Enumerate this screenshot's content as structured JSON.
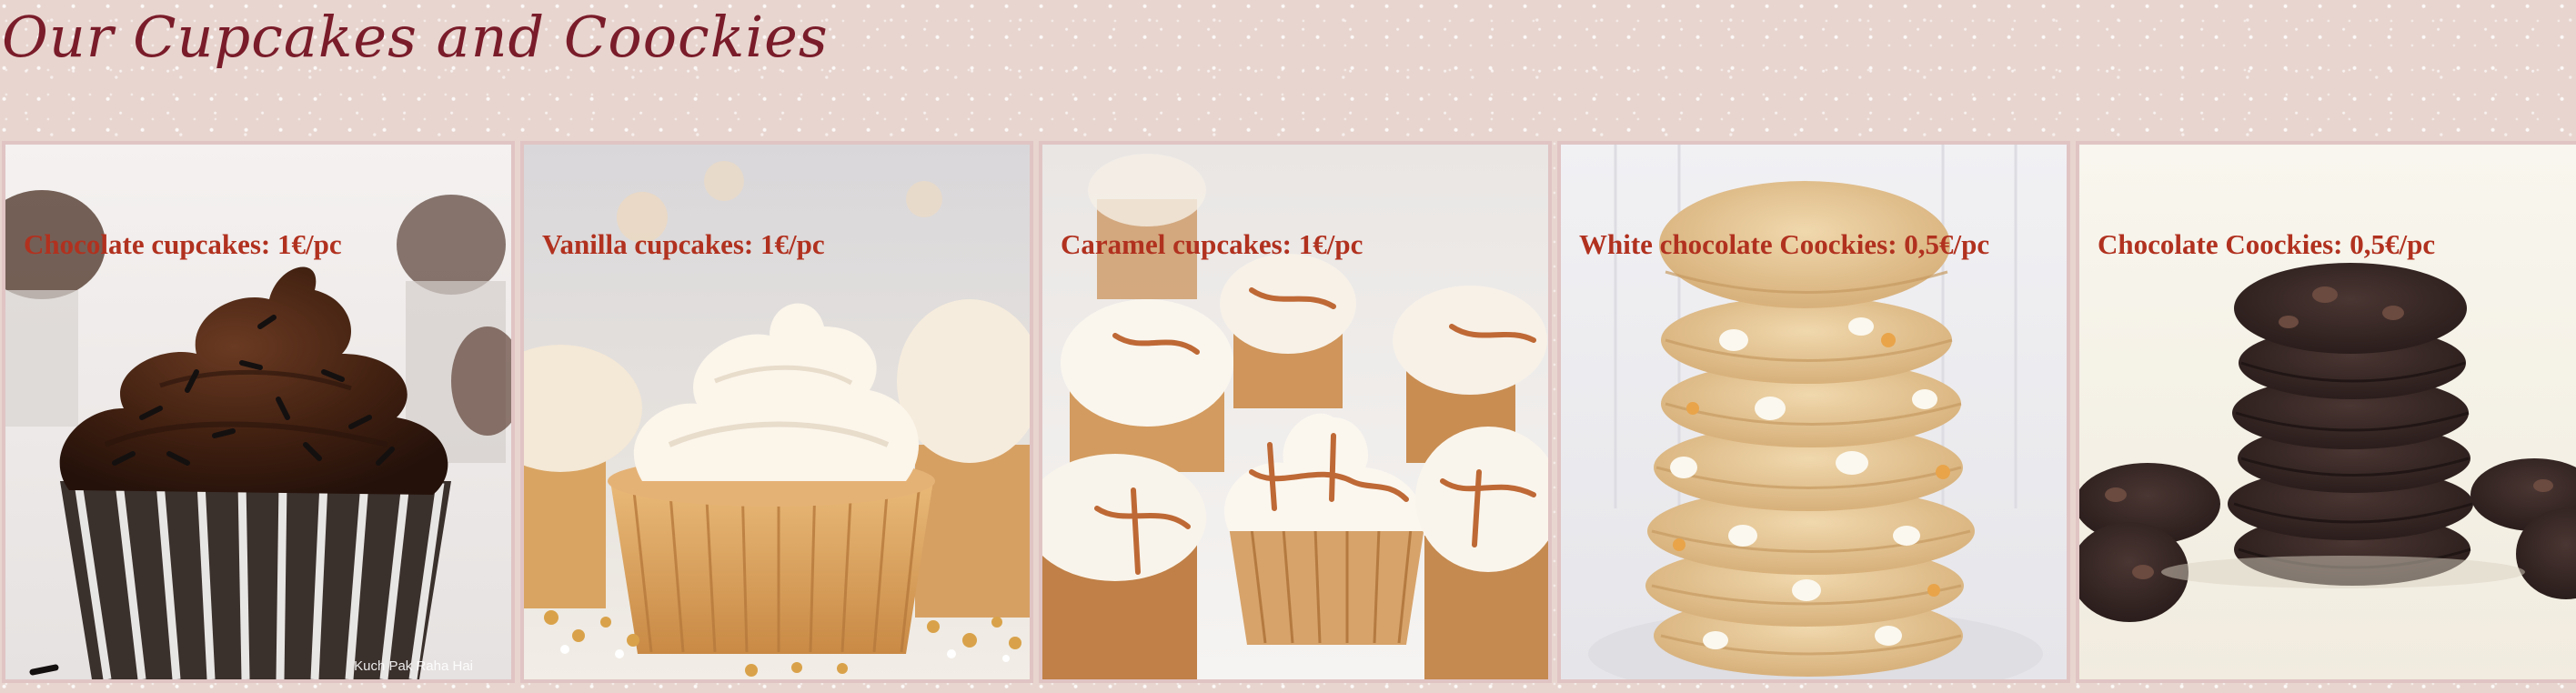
{
  "page": {
    "title": "Our Cupcakes and Coockies"
  },
  "colors": {
    "title": "#7a1c2a",
    "label": "#b1311f",
    "background": "#e8d5cf",
    "card_border": "#e0c4c4"
  },
  "products": [
    {
      "label": "Chocolate cupcakes: 1€/pc",
      "watermark": "Kuch Pak Raha Hai"
    },
    {
      "label": "Vanilla cupcakes: 1€/pc"
    },
    {
      "label": "Caramel cupcakes: 1€/pc"
    },
    {
      "label": "White chocolate Coockies: 0,5€/pc"
    },
    {
      "label": "Chocolate Coockies: 0,5€/pc"
    }
  ]
}
